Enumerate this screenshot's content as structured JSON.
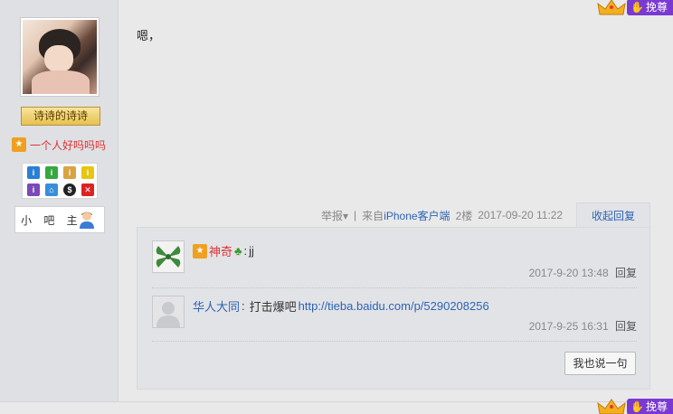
{
  "author": {
    "username": "诗诗的诗诗",
    "level_title": "一个人好吗吗吗",
    "moderator_label": "小 吧 主"
  },
  "post": {
    "text": "嗯，",
    "report_label": "举报",
    "separator": "|",
    "source_prefix": "来自",
    "source_client": "iPhone客户端",
    "floor": "2楼",
    "datetime": "2017-09-20 11:22",
    "collapse_label": "收起回复"
  },
  "revere_label": "挽尊",
  "replies": [
    {
      "user": "神奇",
      "sep": ":",
      "text": "jj",
      "time": "2017-9-20 13:48",
      "reply_label": "回复"
    },
    {
      "user": "华人大同",
      "sep": ":",
      "text": "打击爆吧",
      "link": "http://tieba.baidu.com/p/5290208256",
      "time": "2017-9-25 16:31",
      "reply_label": "回复"
    }
  ],
  "say_button": "我也说一句",
  "colors": {
    "link_blue": "#2d64b3",
    "revere_purple": "#7a3ad1",
    "red_name": "#d33"
  }
}
